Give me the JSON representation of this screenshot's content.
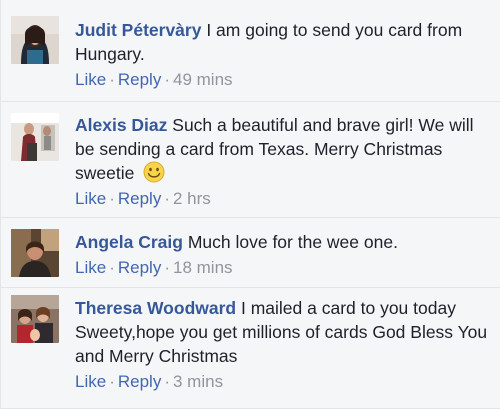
{
  "comments": [
    {
      "author": "Judit Pétervàry",
      "text": "I am going to send you card from Hungary.",
      "like": "Like",
      "reply": "Reply",
      "time": "49 mins"
    },
    {
      "author": "Alexis Diaz",
      "text": "Such a beautiful and brave girl! We will be sending a card from Texas. Merry Christmas sweetie",
      "emoji": "smiley-emoji",
      "like": "Like",
      "reply": "Reply",
      "time": "2 hrs"
    },
    {
      "author": "Angela Craig",
      "text": "Much love for the wee one.",
      "like": "Like",
      "reply": "Reply",
      "time": "18 mins"
    },
    {
      "author": "Theresa Woodward",
      "text": "I mailed a card to you today Sweety,hope you get millions of cards God Bless You and Merry Christmas",
      "like": "Like",
      "reply": "Reply",
      "time": "3 mins"
    }
  ],
  "separator": "·",
  "colors": {
    "author": "#365899",
    "link": "#4267b2",
    "meta": "#90949c",
    "text": "#1d2129",
    "background": "#f5f6f8"
  }
}
